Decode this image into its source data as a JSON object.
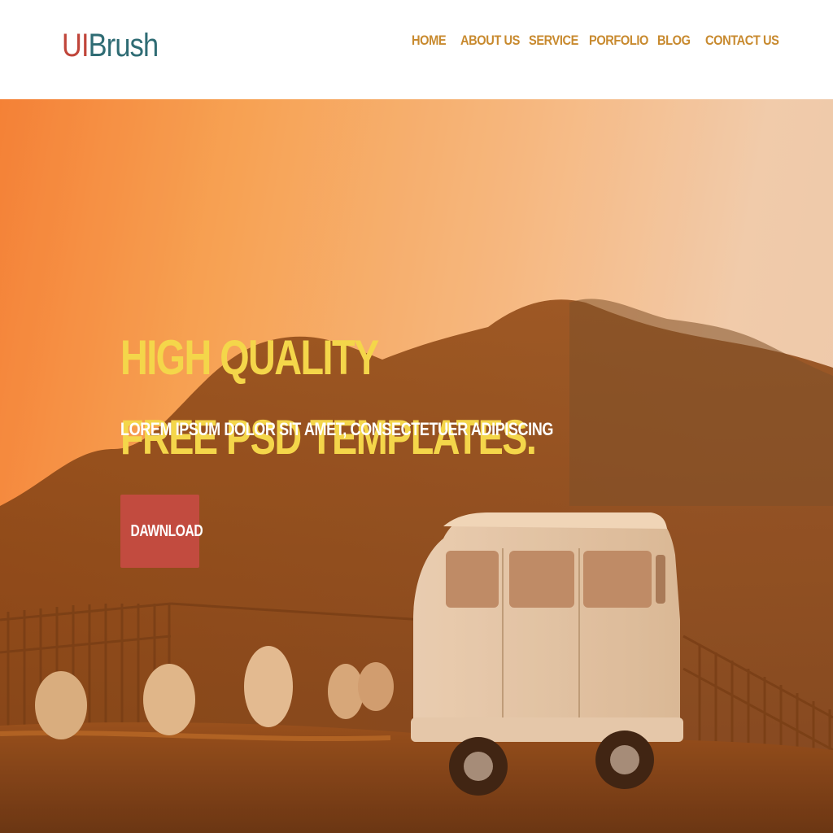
{
  "brand": {
    "part1": "UI",
    "part2": "Brush"
  },
  "nav": {
    "items": [
      {
        "label": "HOME"
      },
      {
        "label": "ABOUT US"
      },
      {
        "label": "SERVICE"
      },
      {
        "label": "PORFOLIO"
      },
      {
        "label": "BLOG"
      },
      {
        "label": "CONTACT US"
      }
    ]
  },
  "hero": {
    "title_line1": "HIGH QUALITY",
    "title_line2": "FREE PSD TEMPLATES.",
    "subtitle": "LOREM IPSUM DOLOR SIT AMET, CONSECTETUER ADIPISCING",
    "cta_label": "DAWNLOAD"
  },
  "colors": {
    "logo_accent": "#c0453a",
    "logo_secondary": "#2f6c74",
    "nav_text": "#c88a2f",
    "headline": "#f4d64a",
    "button": "#c24b3f"
  }
}
